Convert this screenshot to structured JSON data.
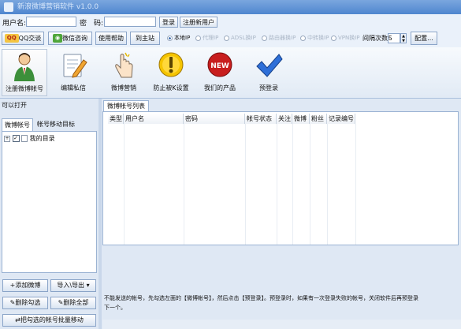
{
  "window": {
    "title": "新浪微博营销软件 v1.0.0"
  },
  "login": {
    "username_label": "用户名:",
    "password_label": "密　码:",
    "login_button": "登录",
    "register_button": "注册新用户"
  },
  "toolbar": {
    "qq_label": "QQ交谈",
    "wechat_label": "微信咨询",
    "help_label": "使用帮助",
    "home_label": "到主站",
    "ip_options": [
      "本地IP",
      "代理IP",
      "ADSL换IP",
      "路由器换IP",
      "中转换IP",
      "VPN换IP"
    ],
    "selected_ip": "本地IP",
    "retry_label": "间隔次数",
    "retry_value": "5",
    "config_label": "配置..."
  },
  "ribbon": [
    {
      "label": "注册微博帐号",
      "icon": "user-icon"
    },
    {
      "label": "编辑私信",
      "icon": "edit-icon"
    },
    {
      "label": "微博营销",
      "icon": "hand-icon"
    },
    {
      "label": "防止被K设置",
      "icon": "shield-icon"
    },
    {
      "label": "我们的产品",
      "icon": "new-badge-icon"
    },
    {
      "label": "预登录",
      "icon": "checkmark-icon"
    }
  ],
  "left": {
    "caption": "可以打开",
    "tabs": [
      "微博帐号",
      "帐号移动目标"
    ],
    "tree_root": "我的目录",
    "buttons": {
      "add": "添加微博",
      "import_export": "导入\\导出",
      "delete_checked": "删除勾选",
      "delete_all": "删除全部",
      "batch_move": "把勾选的帐号批量移动"
    }
  },
  "right": {
    "tab": "微博帐号列表",
    "columns": [
      "类型",
      "用户名",
      "密码",
      "帐号状态",
      "关注",
      "微博",
      "粉丝",
      "记录编号"
    ],
    "notice": "不能发送的帐号，先勾选左面的【微博帐号】，然后点击【预登录】。预登录时，如果有一次登录失败的帐号，关闭软件后再预登录下一个。"
  },
  "colors": {
    "accent": "#4f86cf",
    "panel": "#dfe8f4",
    "qq_red": "#e8442f",
    "wechat_green": "#4fa63a"
  }
}
